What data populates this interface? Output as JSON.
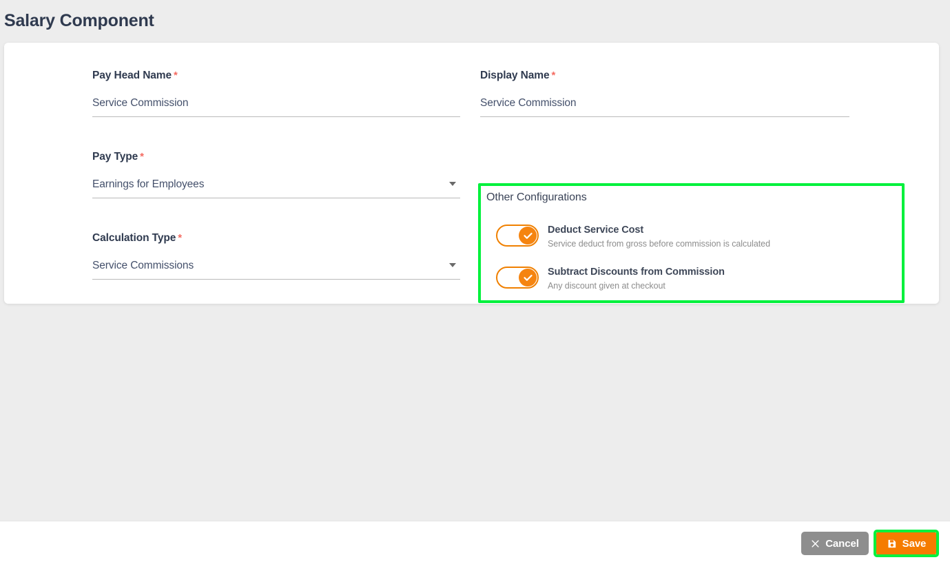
{
  "page": {
    "title": "Salary Component",
    "background_color": "#ededed"
  },
  "form": {
    "left_column": [
      {
        "label": "Pay Head Name",
        "required_marker": "*",
        "value": "Service Commission",
        "type": "text",
        "name": "pay-head-name"
      },
      {
        "label": "Pay Type",
        "required_marker": "*",
        "value": "Earnings for Employees",
        "type": "select",
        "name": "pay-type"
      },
      {
        "label": "Calculation Type",
        "required_marker": "*",
        "value": "Service Commissions",
        "type": "select",
        "name": "calculation-type"
      }
    ],
    "right_column": [
      {
        "label": "Display Name",
        "required_marker": "*",
        "value": "Service Commission",
        "type": "text",
        "name": "display-name"
      }
    ]
  },
  "other_configurations": {
    "title": "Other Configurations",
    "highlight_color": "#00f13c",
    "toggles": [
      {
        "title": "Deduct Service Cost",
        "description": "Service deduct from gross before commission is calculated",
        "state": "on",
        "color": "#f58410"
      },
      {
        "title": "Subtract Discounts from Commission",
        "description": "Any discount given at checkout",
        "state": "on",
        "color": "#f58410"
      }
    ]
  },
  "footer": {
    "cancel_label": "Cancel",
    "cancel_icon": "close-icon",
    "cancel_color": "#8e8e8e",
    "save_label": "Save",
    "save_icon": "save-disk-icon",
    "save_color": "#f57c00",
    "save_highlight_color": "#00f13c"
  }
}
